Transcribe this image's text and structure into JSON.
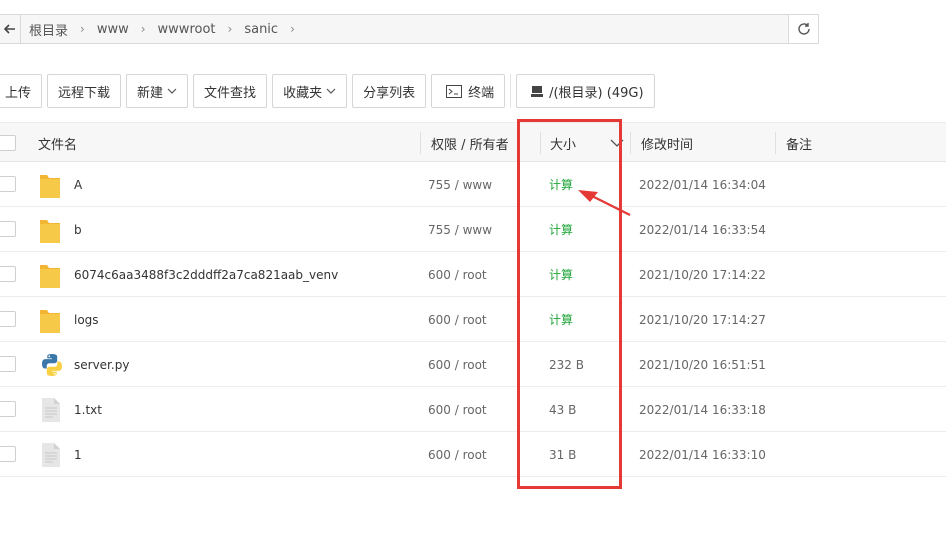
{
  "path": {
    "crumbs": [
      "根目录",
      "www",
      "wwwroot",
      "sanic"
    ]
  },
  "toolbar": {
    "upload": "上传",
    "remote_download": "远程下载",
    "new": "新建",
    "file_search": "文件查找",
    "favorites": "收藏夹",
    "share_list": "分享列表",
    "terminal": "终端",
    "disk": "/(根目录) (49G)"
  },
  "table": {
    "headers": {
      "name": "文件名",
      "perm": "权限 / 所有者",
      "size": "大小",
      "mtime": "修改时间",
      "note": "备注"
    },
    "rows": [
      {
        "type": "folder",
        "name": "A",
        "perm": "755 / www",
        "size": "计算",
        "mtime": "2022/01/14 16:34:04"
      },
      {
        "type": "folder",
        "name": "b",
        "perm": "755 / www",
        "size": "计算",
        "mtime": "2022/01/14 16:33:54"
      },
      {
        "type": "folder",
        "name": "6074c6aa3488f3c2dddff2a7ca821aab_venv",
        "perm": "600 / root",
        "size": "计算",
        "mtime": "2021/10/20 17:14:22"
      },
      {
        "type": "folder",
        "name": "logs",
        "perm": "600 / root",
        "size": "计算",
        "mtime": "2021/10/20 17:14:27"
      },
      {
        "type": "python",
        "name": "server.py",
        "perm": "600 / root",
        "size": "232 B",
        "mtime": "2021/10/20 16:51:51"
      },
      {
        "type": "file",
        "name": "1.txt",
        "perm": "600 / root",
        "size": "43 B",
        "mtime": "2022/01/14 16:33:18"
      },
      {
        "type": "file",
        "name": "1",
        "perm": "600 / root",
        "size": "31 B",
        "mtime": "2022/01/14 16:33:10"
      }
    ]
  },
  "colors": {
    "accent_green": "#20a53a",
    "annotation_red": "#e53935",
    "folder_yellow": "#f7c948"
  }
}
